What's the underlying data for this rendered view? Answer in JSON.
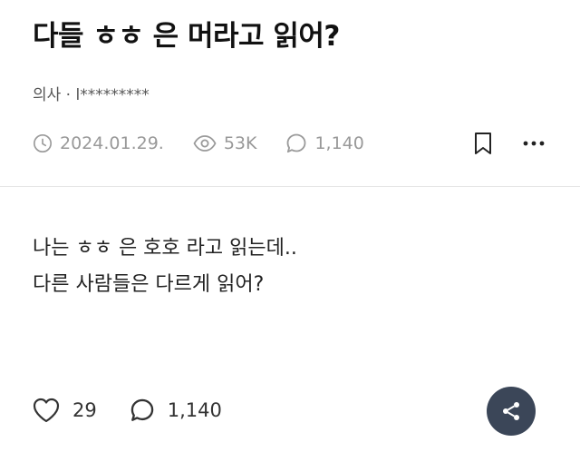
{
  "post": {
    "title": "다들 ㅎㅎ 은 머라고 읽어?",
    "author": "의사 · l*********",
    "date": "2024.01.29.",
    "views": "53K",
    "comments": "1,140",
    "body_lines": [
      "나는 ㅎㅎ 은 호호 라고 읽는데..",
      "다른 사람들은 다르게 읽어?"
    ]
  },
  "footer": {
    "likes": "29",
    "comments": "1,140"
  },
  "icons": {
    "date": "clock-icon",
    "views": "eye-icon",
    "comments": "comment-icon",
    "bookmark": "bookmark-icon",
    "more": "more-icon",
    "like": "heart-icon",
    "share": "share-icon"
  },
  "colors": {
    "meta_text": "#999999",
    "share_button": "#3b4658"
  }
}
